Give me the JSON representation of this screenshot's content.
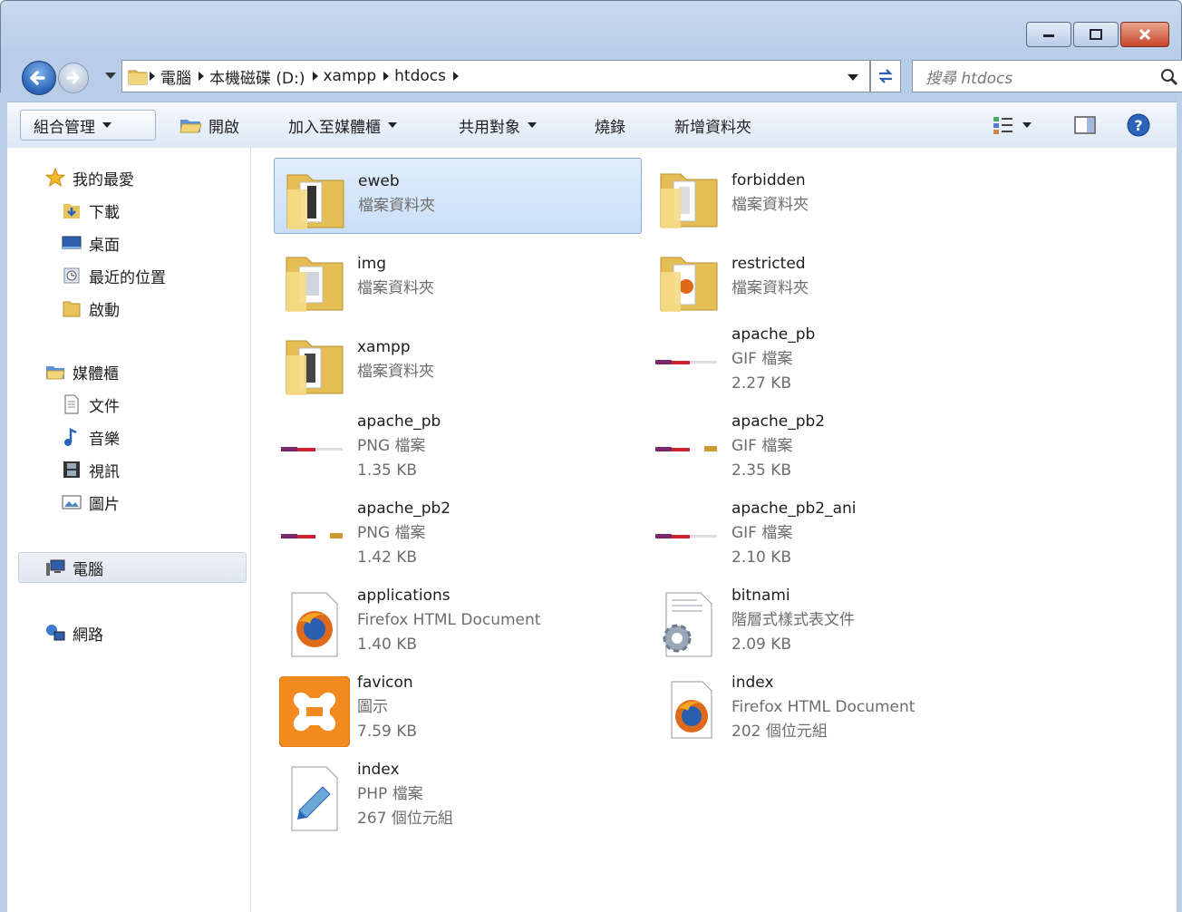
{
  "window": {
    "captions": {
      "minimize": "minimize",
      "maximize": "maximize",
      "close": "close"
    }
  },
  "address": {
    "crumbs": [
      "電腦",
      "本機磁碟 (D:)",
      "xampp",
      "htdocs"
    ],
    "search_placeholder": "搜尋 htdocs"
  },
  "toolbar": {
    "organize": "組合管理",
    "open": "開啟",
    "add_to_library": "加入至媒體櫃",
    "share": "共用對象",
    "burn": "燒錄",
    "new_folder": "新增資料夾"
  },
  "nav": {
    "favorites": "我的最愛",
    "downloads": "下載",
    "desktop": "桌面",
    "recent": "最近的位置",
    "startup": "啟動",
    "libraries": "媒體櫃",
    "documents": "文件",
    "music": "音樂",
    "videos": "視訊",
    "pictures": "圖片",
    "computer": "電腦",
    "network": "網路"
  },
  "items": [
    {
      "name": "eweb",
      "type": "檔案資料夾",
      "size": "",
      "icon": "folder-icon"
    },
    {
      "name": "forbidden",
      "type": "檔案資料夾",
      "size": "",
      "icon": "folder-icon"
    },
    {
      "name": "img",
      "type": "檔案資料夾",
      "size": "",
      "icon": "folder-icon"
    },
    {
      "name": "restricted",
      "type": "檔案資料夾",
      "size": "",
      "icon": "folder-icon"
    },
    {
      "name": "xampp",
      "type": "檔案資料夾",
      "size": "",
      "icon": "folder-icon"
    },
    {
      "name": "apache_pb",
      "type": "GIF 檔案",
      "size": "2.27 KB",
      "icon": "banner-image-icon"
    },
    {
      "name": "apache_pb",
      "type": "PNG 檔案",
      "size": "1.35 KB",
      "icon": "banner-image-icon"
    },
    {
      "name": "apache_pb2",
      "type": "GIF 檔案",
      "size": "2.35 KB",
      "icon": "banner-image-icon"
    },
    {
      "name": "apache_pb2",
      "type": "PNG 檔案",
      "size": "1.42 KB",
      "icon": "banner-image-icon"
    },
    {
      "name": "apache_pb2_ani",
      "type": "GIF 檔案",
      "size": "2.10 KB",
      "icon": "banner-image-icon"
    },
    {
      "name": "applications",
      "type": "Firefox HTML Document",
      "size": "1.40 KB",
      "icon": "firefox-icon"
    },
    {
      "name": "bitnami",
      "type": "階層式樣式表文件",
      "size": "2.09 KB",
      "icon": "css-file-icon"
    },
    {
      "name": "favicon",
      "type": "圖示",
      "size": "7.59 KB",
      "icon": "xampp-icon"
    },
    {
      "name": "index",
      "type": "Firefox HTML Document",
      "size": "202 個位元組",
      "icon": "firefox-icon"
    },
    {
      "name": "index",
      "type": "PHP 檔案",
      "size": "267 個位元組",
      "icon": "php-file-icon"
    }
  ],
  "colors": {
    "selection": "#cce0f7",
    "accent": "#2a63b8"
  }
}
